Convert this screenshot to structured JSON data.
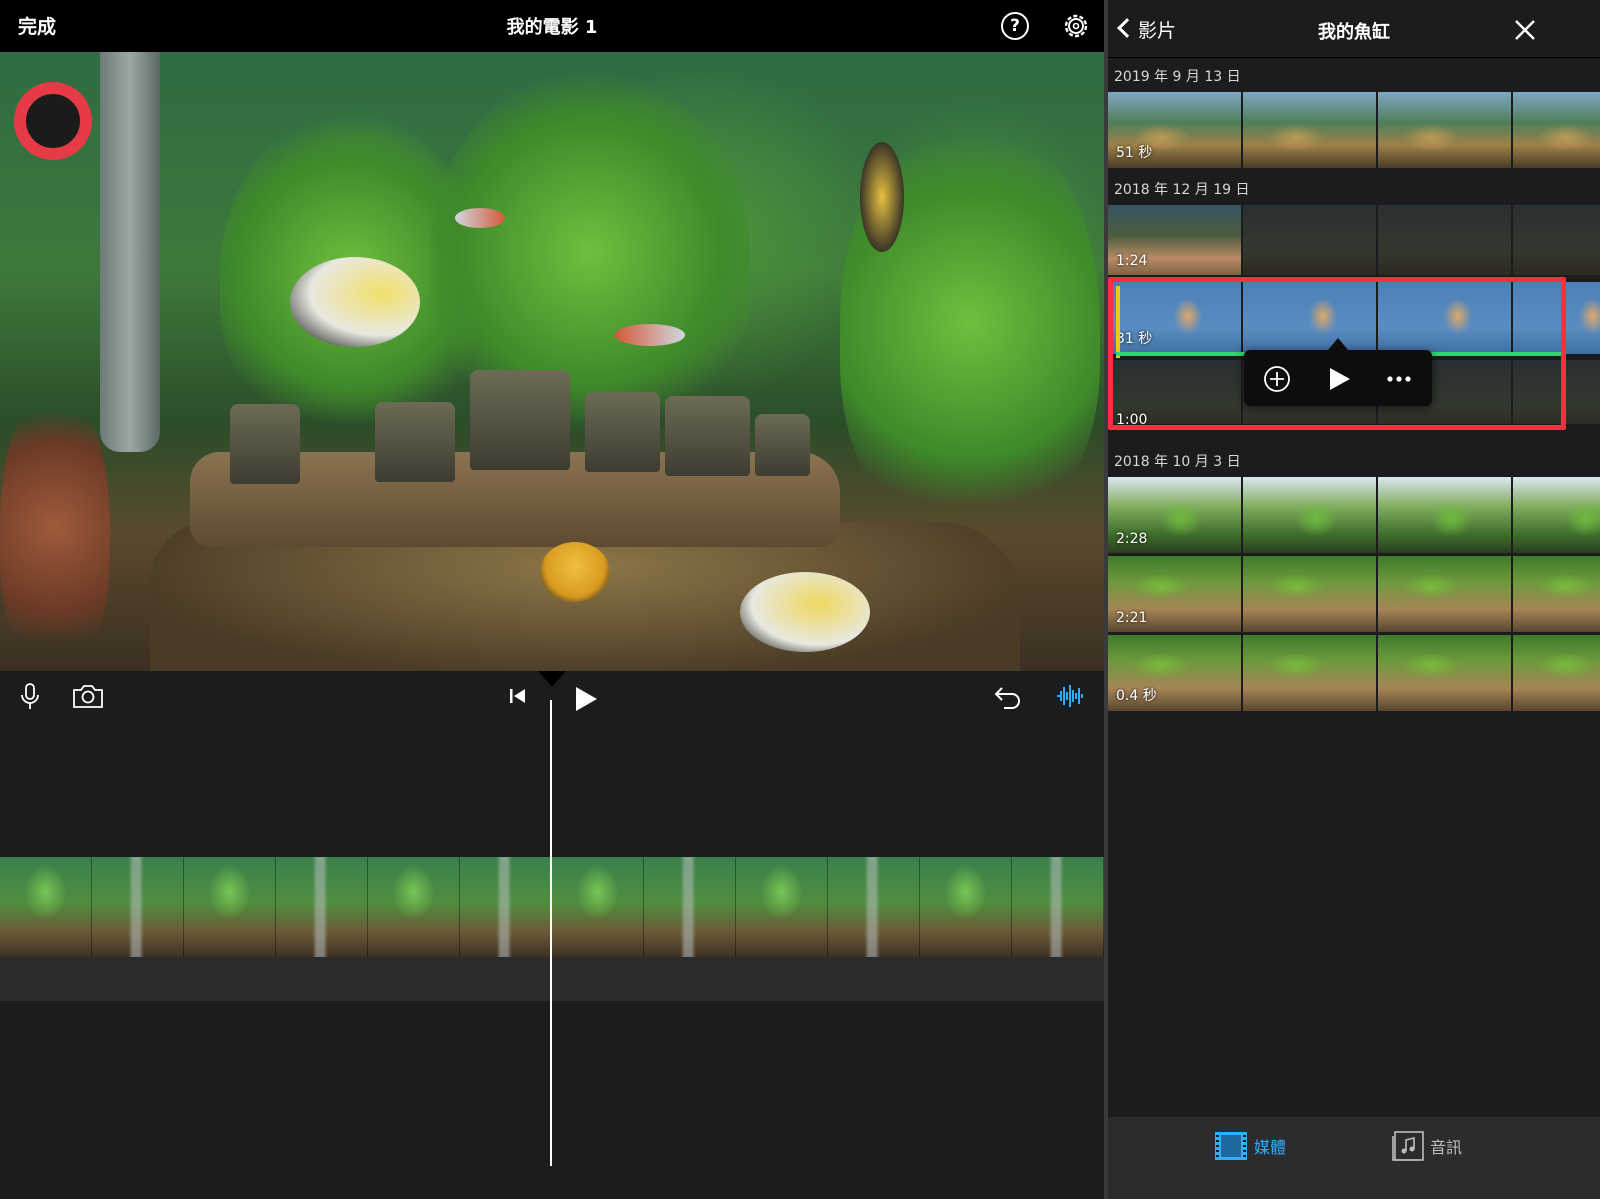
{
  "topbar": {
    "done_label": "完成",
    "project_title": "我的電影 1",
    "help_glyph": "?"
  },
  "icons": {
    "help": "help-icon",
    "settings": "gear-icon",
    "mic": "microphone-icon",
    "camera": "camera-icon",
    "rewind": "skip-to-start-icon",
    "play": "play-icon",
    "undo": "undo-icon",
    "audio": "waveform-icon"
  },
  "colors": {
    "accent": "#2fb0ff",
    "selection": "#ff2d3f",
    "trim_yellow": "#f5c518",
    "audio_green": "#3bd16f",
    "background": "#1c1c1e"
  },
  "media": {
    "back_label": "影片",
    "title": "我的魚缸",
    "groups": [
      {
        "date": "2019 年 9 月 13 日",
        "clips": [
          {
            "duration": "51 秒"
          }
        ]
      },
      {
        "date": "2018 年 12 月 19 日",
        "clips": [
          {
            "duration": "1:24"
          },
          {
            "duration": "31 秒",
            "selected": true
          },
          {
            "duration": "1:00"
          }
        ]
      },
      {
        "date": "2018 年 10 月 3 日",
        "clips": [
          {
            "duration": "2:28"
          },
          {
            "duration": "2:21"
          },
          {
            "duration": "0.4 秒"
          }
        ]
      }
    ],
    "popup_actions": [
      "add-to-project",
      "play",
      "more-options"
    ]
  },
  "tabs": {
    "media_label": "媒體",
    "audio_label": "音訊",
    "active": "媒體"
  }
}
